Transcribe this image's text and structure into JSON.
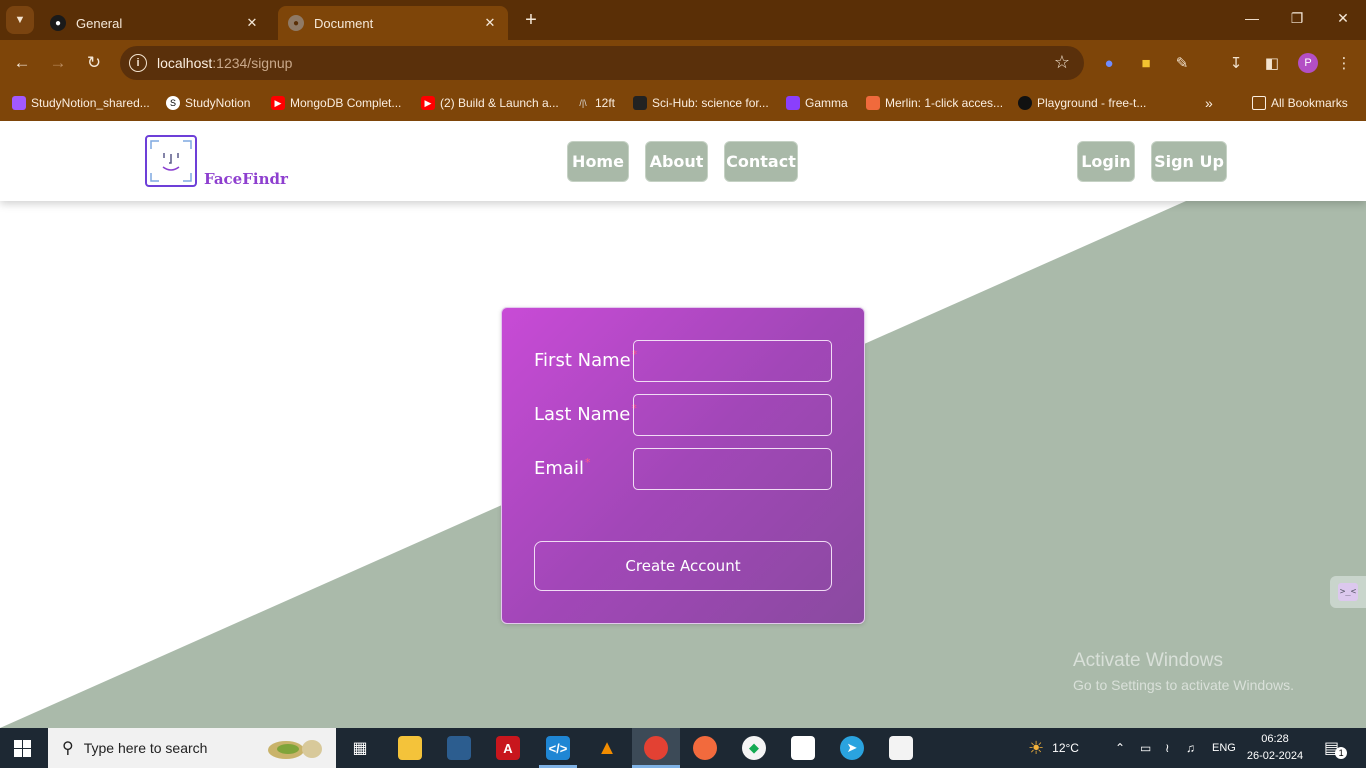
{
  "browser": {
    "tabs": [
      {
        "title": "General",
        "active": false
      },
      {
        "title": "Document",
        "active": true
      }
    ],
    "url": {
      "host": "localhost",
      "path": ":1234/signup"
    },
    "bookmarks": [
      {
        "label": "StudyNotion_shared...",
        "icon": "figma-icon"
      },
      {
        "label": "StudyNotion",
        "icon": "s-logo-icon"
      },
      {
        "label": "MongoDB Complet...",
        "icon": "youtube-icon"
      },
      {
        "label": "(2) Build & Launch a...",
        "icon": "youtube-icon"
      },
      {
        "label": "12ft",
        "icon": "ladder-icon"
      },
      {
        "label": "Sci-Hub: science for...",
        "icon": "scihub-icon"
      },
      {
        "label": "Gamma",
        "icon": "gamma-icon"
      },
      {
        "label": "Merlin: 1-click acces...",
        "icon": "merlin-icon"
      },
      {
        "label": "Playground - free-t...",
        "icon": "openai-icon"
      }
    ],
    "all_bookmarks_label": "All Bookmarks",
    "profile_initial": "P"
  },
  "site": {
    "brand": "FaceFindr",
    "nav": {
      "home": "Home",
      "about": "About",
      "contact": "Contact"
    },
    "auth": {
      "login": "Login",
      "signup": "Sign Up"
    },
    "colors": {
      "nav_button": "#a9b9a8",
      "card_start": "#c84bd6",
      "card_end": "#8a4aa0",
      "diagonal": "#aabaaa"
    }
  },
  "form": {
    "first_name_label": "First Name",
    "last_name_label": "Last Name",
    "email_label": "Email",
    "required_mark": "*",
    "first_name_value": "",
    "last_name_value": "",
    "email_value": "",
    "submit_label": "Create Account"
  },
  "watermark": {
    "line1": "Activate Windows",
    "line2": "Go to Settings to activate Windows."
  },
  "taskbar": {
    "search_placeholder": "Type here to search",
    "weather": "12°C",
    "language": "ENG",
    "time": "06:28",
    "date": "26-02-2024",
    "notification_count": "1"
  }
}
